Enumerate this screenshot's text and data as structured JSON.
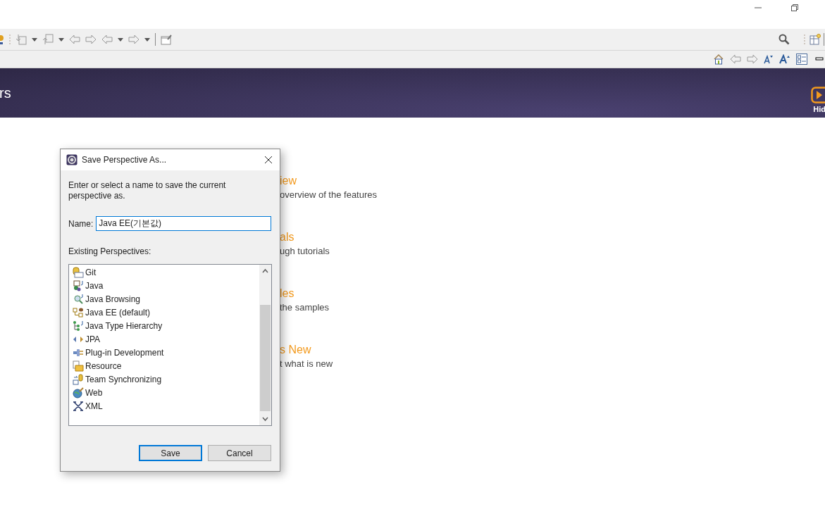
{
  "banner": {
    "title": "rs",
    "hide_label": "Hid"
  },
  "welcome_items": [
    {
      "title": "iew",
      "description": "overview of the features"
    },
    {
      "title": "als",
      "description": "ugh tutorials"
    },
    {
      "title": "les",
      "description": "the samples"
    },
    {
      "title": "s New",
      "description": "t what is new"
    }
  ],
  "dialog": {
    "title": "Save Perspective As...",
    "message": "Enter or select a name to save the current perspective as.",
    "name_label": "Name:",
    "name_value": "Java EE(기본값)",
    "list_label": "Existing Perspectives:",
    "perspectives": [
      {
        "label": "Git",
        "kind": "git"
      },
      {
        "label": "Java",
        "kind": "java"
      },
      {
        "label": "Java Browsing",
        "kind": "browsing"
      },
      {
        "label": "Java EE (default)",
        "kind": "ee"
      },
      {
        "label": "Java Type Hierarchy",
        "kind": "hierarchy"
      },
      {
        "label": "JPA",
        "kind": "jpa"
      },
      {
        "label": "Plug-in Development",
        "kind": "plugin"
      },
      {
        "label": "Resource",
        "kind": "resource"
      },
      {
        "label": "Team Synchronizing",
        "kind": "team"
      },
      {
        "label": "Web",
        "kind": "web"
      },
      {
        "label": "XML",
        "kind": "xml"
      }
    ],
    "buttons": [
      {
        "label": "Save",
        "default": true
      },
      {
        "label": "Cancel",
        "default": false
      }
    ]
  }
}
